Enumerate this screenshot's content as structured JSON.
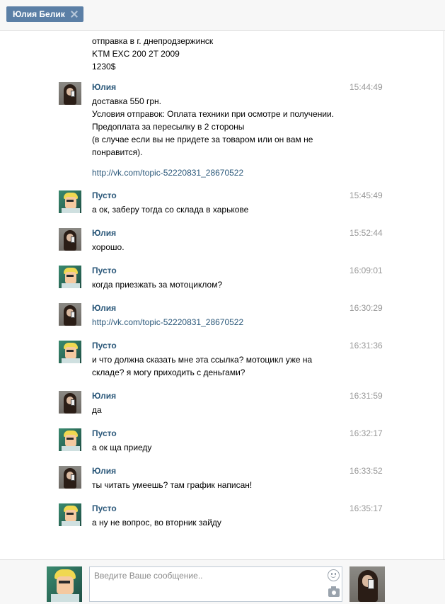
{
  "tab": {
    "label": "Юлия Белик"
  },
  "history": {
    "continuation": [
      "отправка в г. днепродзержинск",
      "KTM EXC 200 2T 2009",
      "1230$"
    ],
    "messages": [
      {
        "author": "Юлия",
        "time": "15:44:49",
        "avatar": "julia",
        "lines": [
          "доставка 550 грн.",
          "Условия отправок: Оплата техники при осмотре и получении.",
          "Предоплата за пересылку в 2 стороны",
          "(в случае если вы не придете за товаром или он вам не",
          "понравится)."
        ],
        "link": "http://vk.com/topic-52220831_28670522"
      },
      {
        "author": "Пусто",
        "time": "15:45:49",
        "avatar": "pusto",
        "lines": [
          "а ок, заберу тогда со склада в харькове"
        ]
      },
      {
        "author": "Юлия",
        "time": "15:52:44",
        "avatar": "julia",
        "lines": [
          "хорошо."
        ]
      },
      {
        "author": "Пусто",
        "time": "16:09:01",
        "avatar": "pusto",
        "lines": [
          "когда приезжать за мотоциклом?"
        ]
      },
      {
        "author": "Юлия",
        "time": "16:30:29",
        "avatar": "julia",
        "lines": [],
        "link": "http://vk.com/topic-52220831_28670522"
      },
      {
        "author": "Пусто",
        "time": "16:31:36",
        "avatar": "pusto",
        "lines": [
          "и что должна сказать мне эта ссылка? мотоцикл уже на",
          "складе? я могу приходить с деньгами?"
        ]
      },
      {
        "author": "Юлия",
        "time": "16:31:59",
        "avatar": "julia",
        "lines": [
          "да"
        ]
      },
      {
        "author": "Пусто",
        "time": "16:32:17",
        "avatar": "pusto",
        "lines": [
          "а ок ща приеду"
        ]
      },
      {
        "author": "Юлия",
        "time": "16:33:52",
        "avatar": "julia",
        "lines": [
          "ты читать умеешь? там график написан!"
        ]
      },
      {
        "author": "Пусто",
        "time": "16:35:17",
        "avatar": "pusto",
        "lines": [
          "а ну не вопрос, во вторник зайду"
        ]
      }
    ]
  },
  "compose": {
    "placeholder": "Введите Ваше сообщение..",
    "value": "",
    "icons": [
      "smile-icon",
      "camera-icon"
    ]
  },
  "colors": {
    "accent": "#5b7fa6",
    "author": "#2b587a",
    "time": "#999999",
    "link": "#2b587a"
  }
}
